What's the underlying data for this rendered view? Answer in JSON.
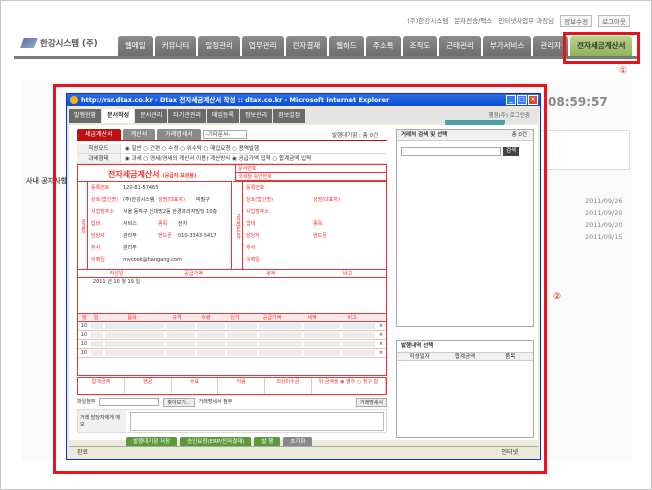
{
  "toplinks": [
    "(주)한강시스템",
    "문자전송/팩스",
    "인터넷사업부 과장님",
    "정보수정",
    "로그아웃"
  ],
  "logo": "한강시스템 (주)",
  "nav": [
    "웹메일",
    "커뮤니티",
    "일정관리",
    "업무관리",
    "전자결재",
    "웹하드",
    "주소록",
    "조직도",
    "근태관리",
    "부가서비스",
    "관리자",
    "전자세금계산서"
  ],
  "annotations": {
    "one": "①",
    "two": "②"
  },
  "background": {
    "clock": "08:59:57",
    "notice_title": "사내 공지사항",
    "dates": [
      "2011/09/26",
      "2011/09/20",
      "2011/09/20",
      "2011/09/15"
    ]
  },
  "window": {
    "title": "http://rsr.dtax.co.kr - Dtax 전자세금계산서 작성 :: dtax.co.kr - Microsoft Internet Explorer",
    "app_tabs": [
      "발행현황",
      "문서작성",
      "문서관리",
      "타기관관리",
      "매입등록",
      "정보관리",
      "정보설정"
    ],
    "user": "행정(주) 로그인중",
    "status_left": "완료",
    "status_right": "인터넷"
  },
  "form": {
    "tabs": [
      "세금계산서",
      "계산서",
      "거래명세서"
    ],
    "doc_dropdown": "-기타문서-",
    "count": "발행대기함 : 총 0건",
    "rows": [
      {
        "label": "작성모드",
        "value": "◉ 일반  ○ 간편  ○ 수정  ○ 위수탁  ○ 매입요청  ○ 용역발행"
      },
      {
        "label": "과세형태",
        "value": "◉ 과세  ○ 영세(영세의 계산서 이용)      계산방식  ◉ 공급가액 입력  ○ 합계금액 입력"
      }
    ],
    "invoice": {
      "title": "전자세금계산서",
      "title_sub": "(공급자 보관용)",
      "meta": [
        "문서번호",
        "국세청 승인번호"
      ],
      "supplier_side": "공급자",
      "buyer_side": "공급받는자",
      "supplier": [
        {
          "label": "등록번호",
          "value": "120-81-57465"
        },
        {
          "label": "상호(법인명)",
          "value": "(주)한강시스템"
        },
        {
          "label": "성명(대표자)",
          "value": "박필구"
        },
        {
          "label": "사업장주소",
          "value": "서울 동작구 신대방2동 한경프라자빌딩 10층"
        },
        {
          "label": "업태",
          "value": "서비스"
        },
        {
          "label": "종목",
          "value": "전자"
        },
        {
          "label": "담당자",
          "value": "관리부"
        },
        {
          "label": "핸드폰",
          "value": "010-3343-5417"
        },
        {
          "label": "부서",
          "value": "관리부"
        },
        {
          "label": "이메일",
          "value": "mvcook@hangang.com"
        }
      ],
      "buyer": [
        "등록번호",
        "상호(법인명)",
        "성명(대표자)",
        "사업장주소",
        "업태",
        "종목",
        "담당자",
        "핸드폰",
        "부서",
        "이메일"
      ],
      "bottom_headers": [
        "작성일",
        "공급가액",
        "세액",
        "비고"
      ],
      "date": "2011 년 10 월 19 일"
    },
    "items_head": [
      "월",
      "일",
      "품목",
      "규격",
      "수량",
      "단가",
      "공급가액",
      "세액",
      "비고"
    ],
    "items": [
      {
        "m": "10",
        "d": ""
      },
      {
        "m": "10",
        "d": ""
      },
      {
        "m": "10",
        "d": ""
      },
      {
        "m": "10",
        "d": ""
      }
    ],
    "totals": [
      "합계금액",
      "현금",
      "수표",
      "어음",
      "외상미수금"
    ],
    "payment": "위 금액을  ◉ 영수  ○ 청구 함",
    "attach_label": "파일첨부",
    "attach_btn": "찾아보기...",
    "trade_label": "거래명세서 첨부",
    "trade_btn": "거래명세서",
    "memo_label": "거래 담당자에게 메모",
    "actions": [
      "발행대기함 저장",
      "승인요청(ERP/전자결재)",
      "발 행",
      "초기화"
    ]
  },
  "right": {
    "search_title": "거래처 검색 및 선택",
    "search_count": "총 0건",
    "search_btn": "검색",
    "history_title": "발행내역 선택",
    "history_cols": [
      "작성일자",
      "합계금액",
      "품목"
    ]
  }
}
